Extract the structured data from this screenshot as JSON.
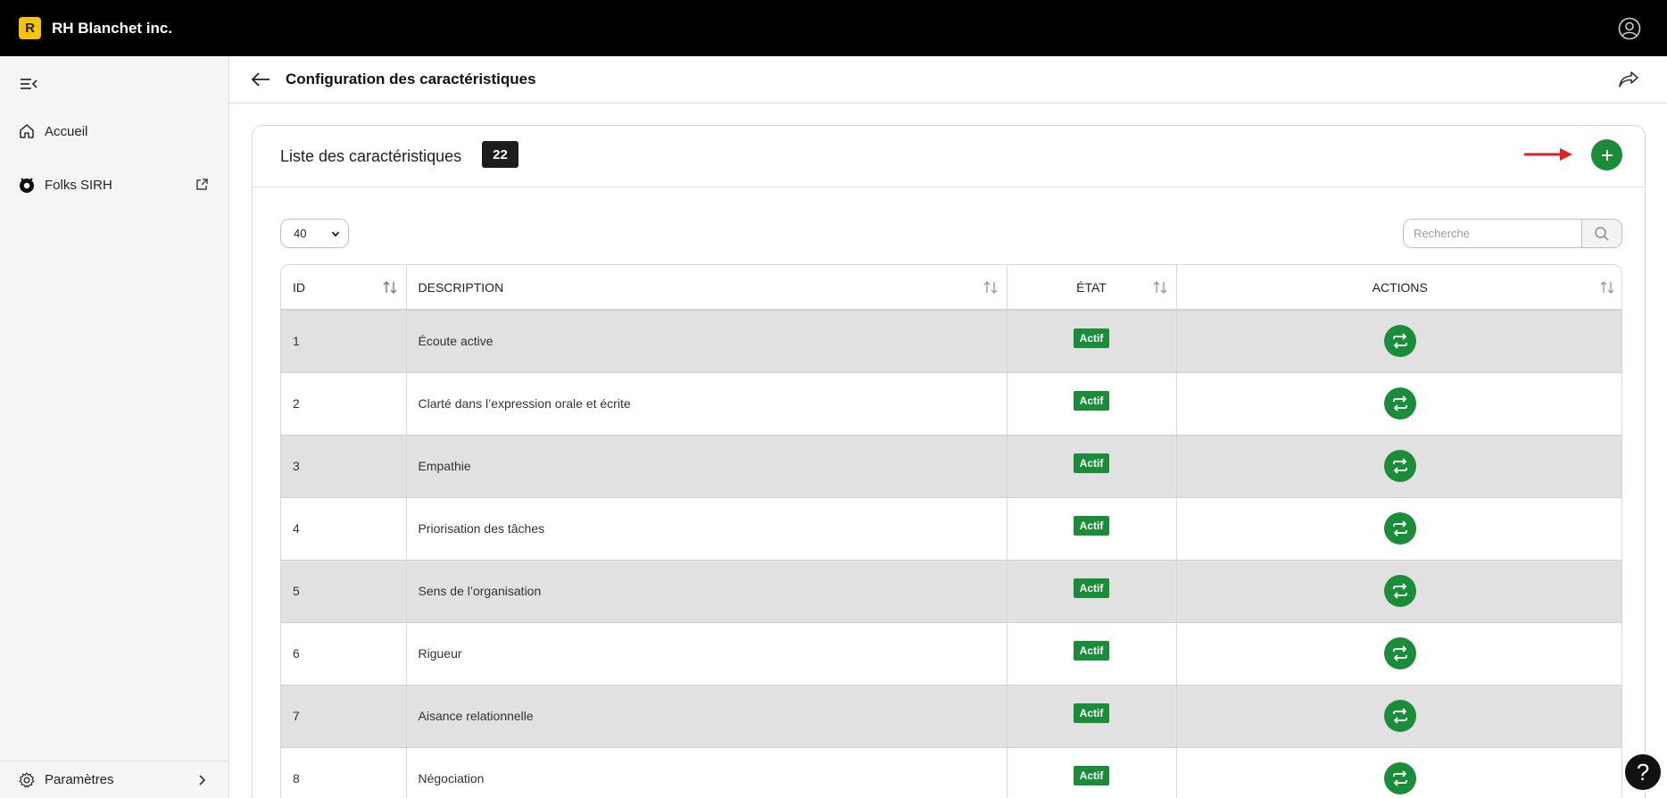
{
  "app": {
    "logo_letter": "R",
    "company": "RH Blanchet inc."
  },
  "sidebar": {
    "items": [
      {
        "label": "Accueil",
        "icon": "home-icon"
      },
      {
        "label": "Folks SIRH",
        "icon": "folks-logo-icon",
        "trailing_icon": "external-link-icon"
      }
    ],
    "settings": {
      "label": "Paramètres",
      "icon": "gear-icon",
      "trailing_icon": "chevron-right-icon"
    }
  },
  "header": {
    "title": "Configuration des caractéristiques"
  },
  "list": {
    "title": "Liste des caractéristiques",
    "count": "22",
    "page_size": "40",
    "search_placeholder": "Recherche"
  },
  "table": {
    "columns": [
      "ID",
      "DESCRIPTION",
      "ÉTAT",
      "ACTIONS"
    ],
    "rows": [
      {
        "id": "1",
        "description": "Écoute active",
        "status": "Actif"
      },
      {
        "id": "2",
        "description": "Clarté dans l’expression orale et écrite",
        "status": "Actif"
      },
      {
        "id": "3",
        "description": "Empathie",
        "status": "Actif"
      },
      {
        "id": "4",
        "description": "Priorisation des tâches",
        "status": "Actif"
      },
      {
        "id": "5",
        "description": "Sens de l’organisation",
        "status": "Actif"
      },
      {
        "id": "6",
        "description": "Rigueur",
        "status": "Actif"
      },
      {
        "id": "7",
        "description": "Aisance relationnelle",
        "status": "Actif"
      },
      {
        "id": "8",
        "description": "Négociation",
        "status": "Actif"
      }
    ]
  },
  "help": {
    "label": "?"
  },
  "colors": {
    "accent_green": "#1a8c3a",
    "topbar": "#000000",
    "logo_yellow": "#f6c300",
    "annotation_red": "#e02020"
  }
}
